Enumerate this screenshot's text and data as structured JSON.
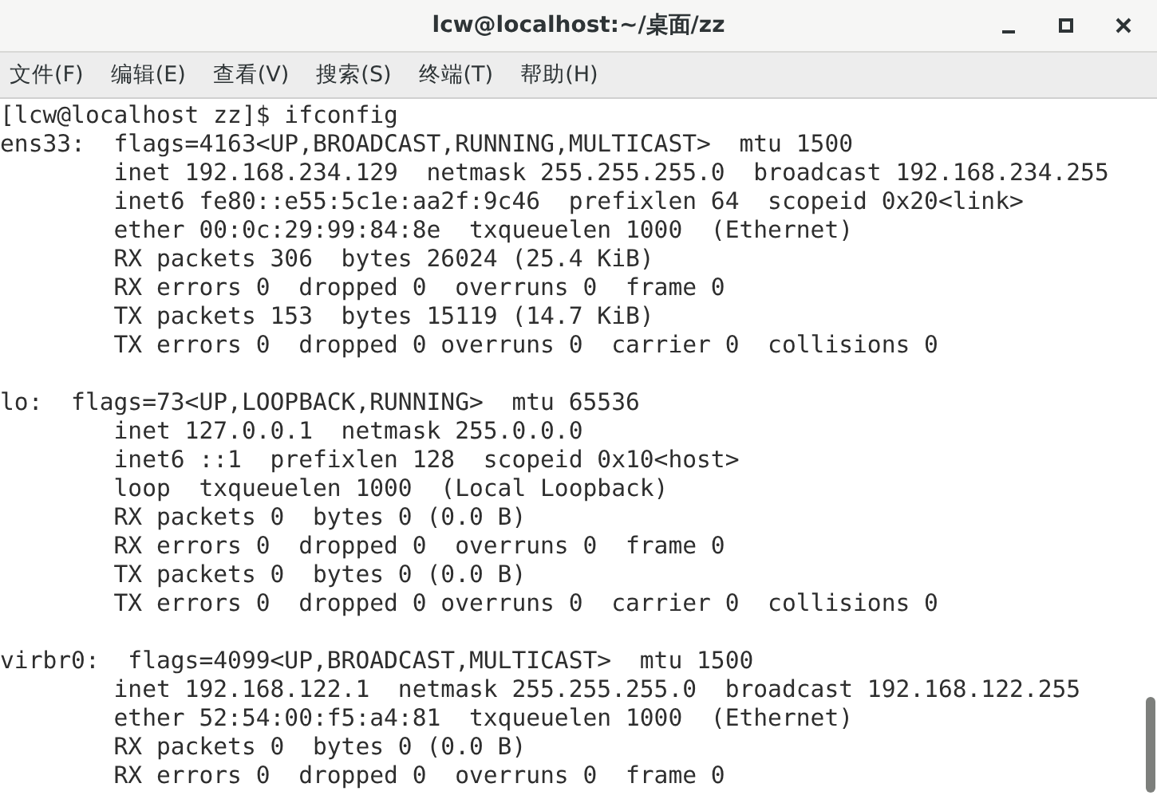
{
  "window": {
    "title": "lcw@localhost:~/桌面/zz"
  },
  "menu": [
    "文件(F)",
    "编辑(E)",
    "查看(V)",
    "搜索(S)",
    "终端(T)",
    "帮助(H)"
  ],
  "terminal": {
    "prompt": "[lcw@localhost zz]$ ifconfig",
    "blocks": [
      {
        "lines": [
          "ens33:  flags=4163<UP,BROADCAST,RUNNING,MULTICAST>  mtu 1500",
          "        inet 192.168.234.129  netmask 255.255.255.0  broadcast 192.168.234.255",
          "        inet6 fe80::e55:5c1e:aa2f:9c46  prefixlen 64  scopeid 0x20<link>",
          "        ether 00:0c:29:99:84:8e  txqueuelen 1000  (Ethernet)",
          "        RX packets 306  bytes 26024 (25.4 KiB)",
          "        RX errors 0  dropped 0  overruns 0  frame 0",
          "        TX packets 153  bytes 15119 (14.7 KiB)",
          "        TX errors 0  dropped 0 overruns 0  carrier 0  collisions 0"
        ]
      },
      {
        "lines": [
          "lo:  flags=73<UP,LOOPBACK,RUNNING>  mtu 65536",
          "        inet 127.0.0.1  netmask 255.0.0.0",
          "        inet6 ::1  prefixlen 128  scopeid 0x10<host>",
          "        loop  txqueuelen 1000  (Local Loopback)",
          "        RX packets 0  bytes 0 (0.0 B)",
          "        RX errors 0  dropped 0  overruns 0  frame 0",
          "        TX packets 0  bytes 0 (0.0 B)",
          "        TX errors 0  dropped 0 overruns 0  carrier 0  collisions 0"
        ]
      },
      {
        "lines": [
          "virbr0:  flags=4099<UP,BROADCAST,MULTICAST>  mtu 1500",
          "        inet 192.168.122.1  netmask 255.255.255.0  broadcast 192.168.122.255",
          "        ether 52:54:00:f5:a4:81  txqueuelen 1000  (Ethernet)",
          "        RX packets 0  bytes 0 (0.0 B)",
          "        RX errors 0  dropped 0  overruns 0  frame 0"
        ]
      }
    ]
  }
}
